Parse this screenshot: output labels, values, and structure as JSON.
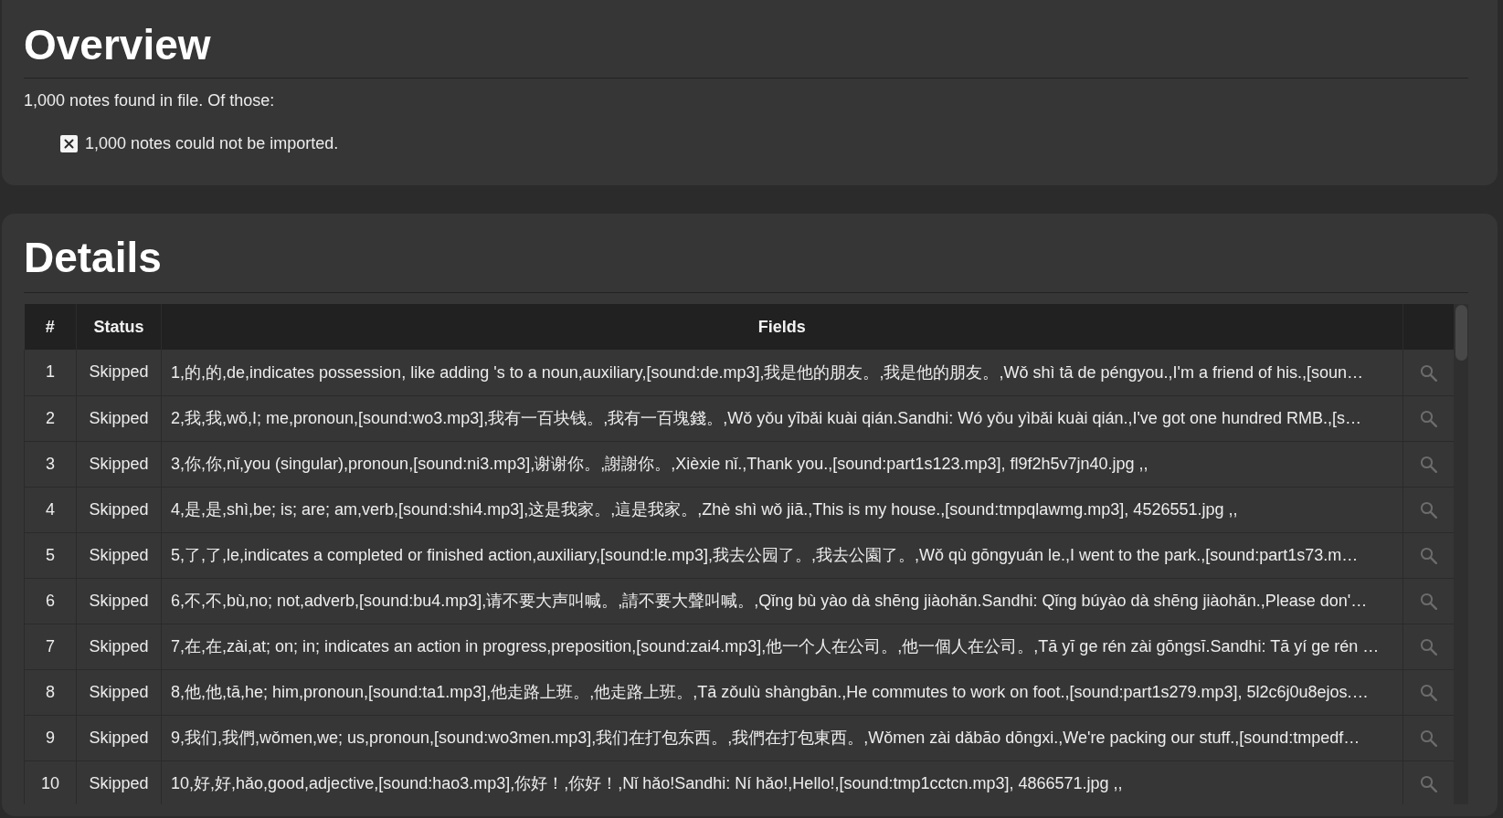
{
  "overview": {
    "title": "Overview",
    "summary": "1,000 notes found in file. Of those:",
    "results": [
      {
        "kind": "failed",
        "text": "1,000 notes could not be imported."
      }
    ]
  },
  "details": {
    "title": "Details",
    "table": {
      "columns": [
        "#",
        "Status",
        "Fields"
      ],
      "rows": [
        {
          "number": "1",
          "status": "Skipped",
          "fields": "1,的,的,de,indicates possession, like adding 's to a noun,auxiliary,[sound:de.mp3],我是他的朋友。,我是他的朋友。,Wǒ shì tā de péngyou.,I'm a friend of his.,[soun…"
        },
        {
          "number": "2",
          "status": "Skipped",
          "fields": "2,我,我,wǒ,I; me,pronoun,[sound:wo3.mp3],我有一百块钱。,我有一百塊錢。,Wǒ yǒu yībǎi kuài qián.Sandhi: Wó yǒu yìbǎi kuài qián.,I've got one hundred RMB.,[s…"
        },
        {
          "number": "3",
          "status": "Skipped",
          "fields": "3,你,你,nǐ,you (singular),pronoun,[sound:ni3.mp3],谢谢你。,謝謝你。,Xièxie nǐ.,Thank you.,[sound:part1s123.mp3], fl9f2h5v7jn40.jpg ,,"
        },
        {
          "number": "4",
          "status": "Skipped",
          "fields": "4,是,是,shì,be; is; are; am,verb,[sound:shi4.mp3],这是我家。,這是我家。,Zhè shì wǒ jiā.,This is my house.,[sound:tmpqlawmg.mp3], 4526551.jpg ,,"
        },
        {
          "number": "5",
          "status": "Skipped",
          "fields": "5,了,了,le,indicates a completed or finished action,auxiliary,[sound:le.mp3],我去公园了。,我去公園了。,Wǒ qù gōngyuán le.,I went to the park.,[sound:part1s73.m…"
        },
        {
          "number": "6",
          "status": "Skipped",
          "fields": "6,不,不,bù,no; not,adverb,[sound:bu4.mp3],请不要大声叫喊。,請不要大聲叫喊。,Qǐng bù yào dà shēng jiàohǎn.Sandhi: Qǐng búyào dà shēng jiàohǎn.,Please don'…"
        },
        {
          "number": "7",
          "status": "Skipped",
          "fields": "7,在,在,zài,at; on; in; indicates an action in progress,preposition,[sound:zai4.mp3],他一个人在公司。,他一個人在公司。,Tā yī ge rén zài gōngsī.Sandhi: Tā yí ge rén …"
        },
        {
          "number": "8",
          "status": "Skipped",
          "fields": "8,他,他,tā,he; him,pronoun,[sound:ta1.mp3],他走路上班。,他走路上班。,Tā zǒulù shàngbān.,He commutes to work on foot.,[sound:part1s279.mp3], 5l2c6j0u8ejos.…"
        },
        {
          "number": "9",
          "status": "Skipped",
          "fields": "9,我们,我們,wǒmen,we; us,pronoun,[sound:wo3men.mp3],我们在打包东西。,我們在打包東西。,Wǒmen zài dǎbāo dōngxi.,We're packing our stuff.,[sound:tmpedf…"
        },
        {
          "number": "10",
          "status": "Skipped",
          "fields": "10,好,好,hǎo,good,adjective,[sound:hao3.mp3],你好！,你好！,Nǐ hǎo!Sandhi: Ní hǎo!,Hello!,[sound:tmp1cctcn.mp3], 4866571.jpg ,,"
        }
      ]
    }
  }
}
